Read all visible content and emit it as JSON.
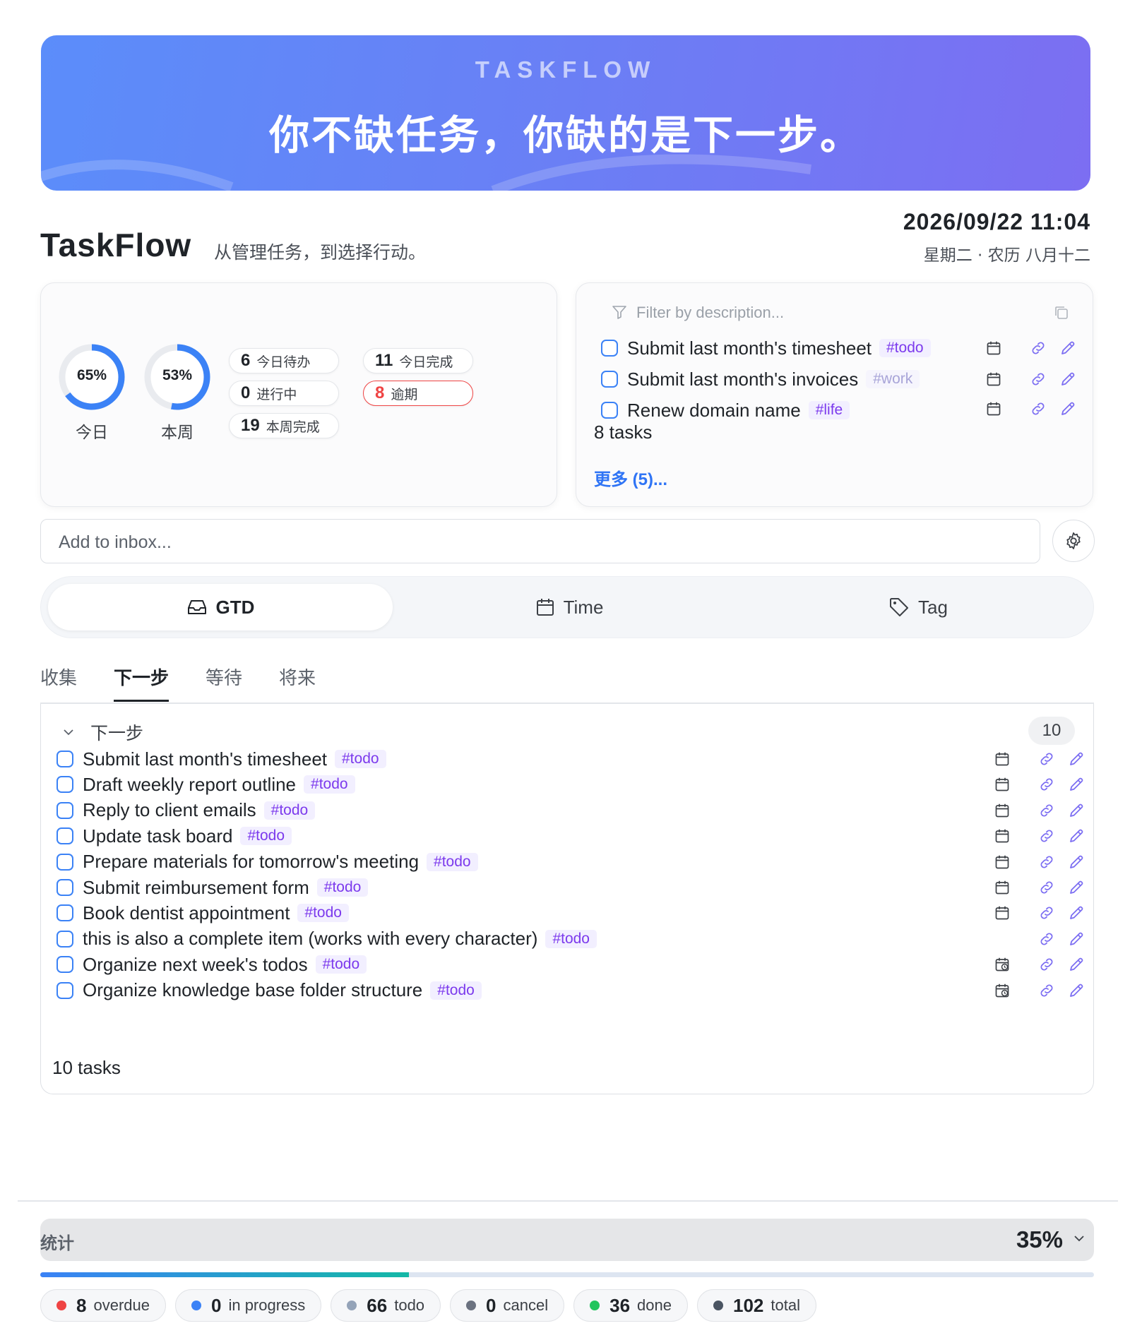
{
  "banner": {
    "brand": "TASKFLOW",
    "slogan": "你不缺任务，你缺的是下一步。"
  },
  "header": {
    "title": "TaskFlow",
    "subtitle": "从管理任务，到选择行动。",
    "datetime": "2026/09/22 11:04",
    "lunar": "星期二 · 农历 八月十二"
  },
  "rings": [
    {
      "percent": "65%",
      "value": 0.65,
      "label": "今日"
    },
    {
      "percent": "53%",
      "value": 0.53,
      "label": "本周"
    }
  ],
  "pills": [
    {
      "num": "6",
      "label": "今日待办"
    },
    {
      "num": "11",
      "label": "今日完成"
    },
    {
      "num": "0",
      "label": "进行中"
    },
    {
      "num": "8",
      "label": "逾期"
    },
    {
      "num": "19",
      "label": "本周完成"
    }
  ],
  "due": {
    "filter_placeholder": "Filter by description...",
    "tasks": [
      {
        "text": "Submit last month's timesheet",
        "tag": "#todo"
      },
      {
        "text": "Submit last month's invoices",
        "tag": "#work"
      },
      {
        "text": "Renew domain name",
        "tag": "#life"
      }
    ],
    "count": "8 tasks",
    "more": "更多 (5)..."
  },
  "inbox": {
    "placeholder": "Add to inbox..."
  },
  "views": [
    {
      "label": "GTD",
      "icon": "inbox-icon"
    },
    {
      "label": "Time",
      "icon": "calendar-icon"
    },
    {
      "label": "Tag",
      "icon": "tag-icon"
    }
  ],
  "subtabs": [
    "收集",
    "下一步",
    "等待",
    "将来"
  ],
  "group": {
    "title": "下一步",
    "count": "10",
    "tasks": [
      {
        "text": "Submit last month's timesheet",
        "tag": "#todo",
        "date_icon": "calendar-icon"
      },
      {
        "text": "Draft weekly report outline",
        "tag": "#todo",
        "date_icon": "calendar-icon"
      },
      {
        "text": "Reply to client emails",
        "tag": "#todo",
        "date_icon": "calendar-icon"
      },
      {
        "text": "Update task board",
        "tag": "#todo",
        "date_icon": "calendar-icon"
      },
      {
        "text": "Prepare materials for tomorrow's meeting",
        "tag": "#todo",
        "date_icon": "calendar-icon"
      },
      {
        "text": "Submit reimbursement form",
        "tag": "#todo",
        "date_icon": "calendar-icon"
      },
      {
        "text": "Book dentist appointment",
        "tag": "#todo",
        "date_icon": "calendar-icon"
      },
      {
        "text": "this is also a complete item (works with every character)",
        "tag": "#todo",
        "date_icon": ""
      },
      {
        "text": "Organize next week's todos",
        "tag": "#todo",
        "date_icon": "calendar-clock-icon"
      },
      {
        "text": "Organize knowledge base folder structure",
        "tag": "#todo",
        "date_icon": "calendar-clock-icon"
      }
    ],
    "count_text": "10 tasks"
  },
  "stats": {
    "label": "统计",
    "percent": "35%",
    "progress": 0.35,
    "chips": [
      {
        "num": "8",
        "label": "overdue",
        "color": "#ef4444"
      },
      {
        "num": "0",
        "label": "in progress",
        "color": "#3b82f6"
      },
      {
        "num": "66",
        "label": "todo",
        "color": "#94a3b8"
      },
      {
        "num": "0",
        "label": "cancel",
        "color": "#6b7280"
      },
      {
        "num": "36",
        "label": "done",
        "color": "#22c55e"
      },
      {
        "num": "102",
        "label": "total",
        "color": "#4b5563"
      }
    ]
  },
  "colors": {
    "accent": "#3b82f6",
    "tag": "#7c3aed",
    "overdue": "#ef4444"
  }
}
